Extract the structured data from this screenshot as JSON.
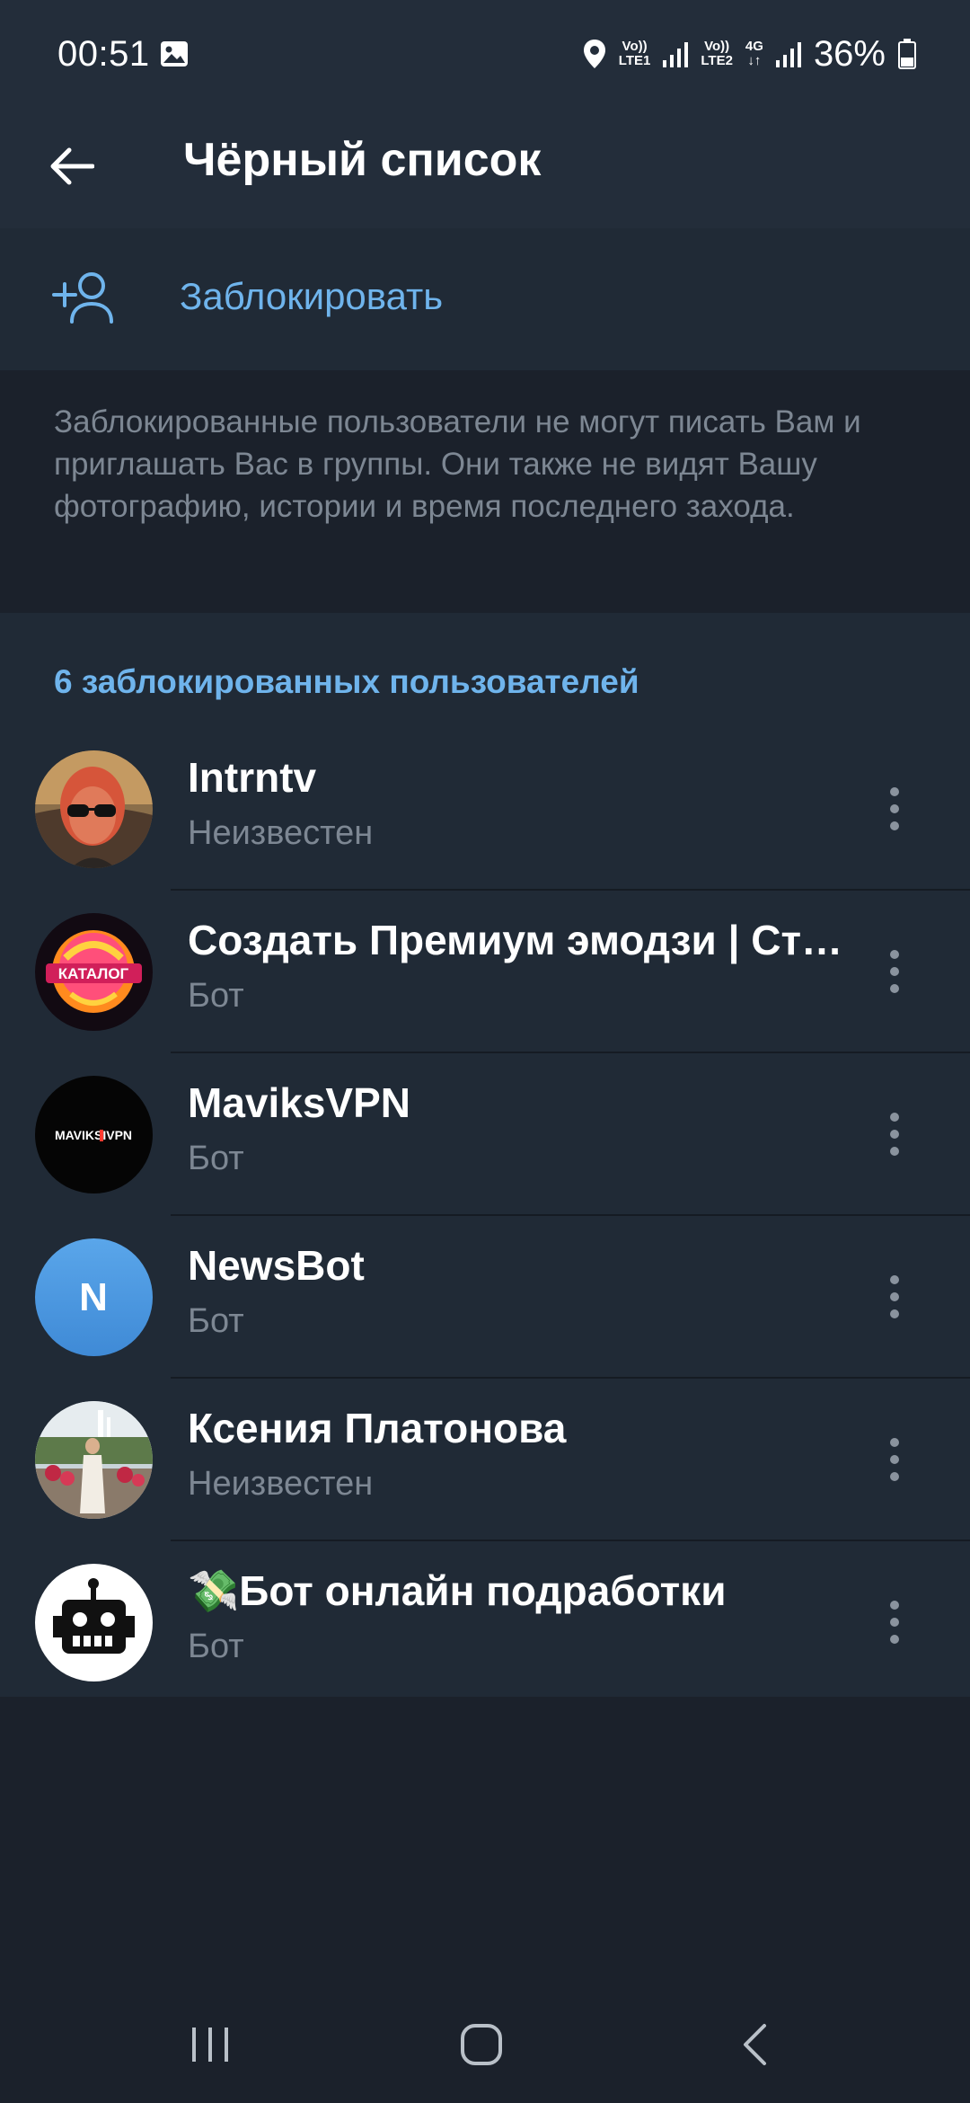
{
  "status_bar": {
    "time": "00:51",
    "sim1_label_top": "Vo))",
    "sim1_label_bottom": "LTE1",
    "sim2_label_top": "Vo))",
    "sim2_label_bottom": "LTE2",
    "network_type": "4G",
    "battery": "36%"
  },
  "app_bar": {
    "title": "Чёрный список"
  },
  "block_action": {
    "label": "Заблокировать"
  },
  "info": {
    "text": "Заблокированные пользователи не могут писать Вам и приглашать Вас в группы. Они также не видят Вашу фотографию, истории и время последнего захода."
  },
  "blocked_list": {
    "header": "6 заблокированных пользователей",
    "users": [
      {
        "name": "Intrntv",
        "status": "Неизвестен",
        "avatar": "photo-woman-sunglasses"
      },
      {
        "name": "Создать Премиум эмодзи | Стикеры",
        "status": "Бот",
        "avatar_text": "КАТАЛОГ"
      },
      {
        "name": "MaviksVPN",
        "status": "Бот",
        "avatar_text": "MAVIKSIVPN"
      },
      {
        "name": "NewsBot",
        "status": "Бот",
        "avatar_text": "N"
      },
      {
        "name": "Ксения Платонова",
        "status": "Неизвестен",
        "avatar": "photo-woman-fountain"
      },
      {
        "name": "💸Бот онлайн подработки",
        "status": "Бот",
        "avatar": "robot-icon"
      }
    ]
  },
  "colors": {
    "accent": "#6fb4ec",
    "background": "#1b212b",
    "surface": "#202a36",
    "app_bar": "#232d3a",
    "secondary_text": "#7d8793",
    "newsbot_avatar": "#4b98e0"
  }
}
